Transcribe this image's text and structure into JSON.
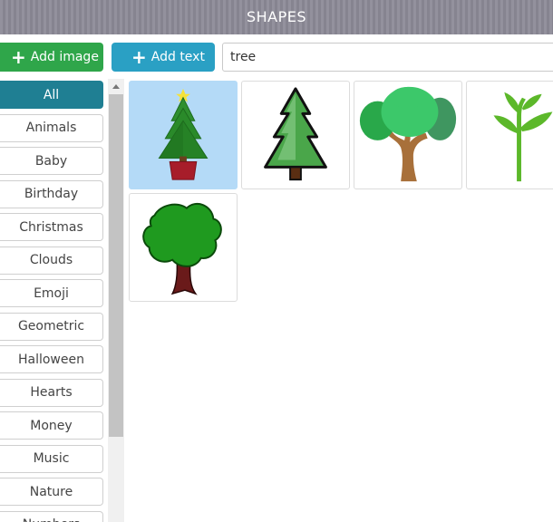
{
  "header": {
    "title": "SHAPES"
  },
  "toolbar": {
    "add_image_label": "Add image",
    "add_text_label": "Add text",
    "search_value": "tree"
  },
  "categories": [
    "All",
    "Animals",
    "Baby",
    "Birthday",
    "Christmas",
    "Clouds",
    "Emoji",
    "Geometric",
    "Halloween",
    "Hearts",
    "Money",
    "Music",
    "Nature",
    "Numbers"
  ],
  "selected_category": "All",
  "results": [
    {
      "icon": "christmas-tree-icon",
      "selected": true
    },
    {
      "icon": "pine-tree-icon",
      "selected": false
    },
    {
      "icon": "leafy-tree-icon",
      "selected": false
    },
    {
      "icon": "sprout-icon",
      "selected": false
    },
    {
      "icon": "round-tree-icon",
      "selected": false
    }
  ],
  "colors": {
    "add_image": "#2fa64a",
    "add_text": "#2aa0c4",
    "active_category": "#1f7f93",
    "selected_tile": "#b4daf7",
    "header": "#8d8b98"
  }
}
